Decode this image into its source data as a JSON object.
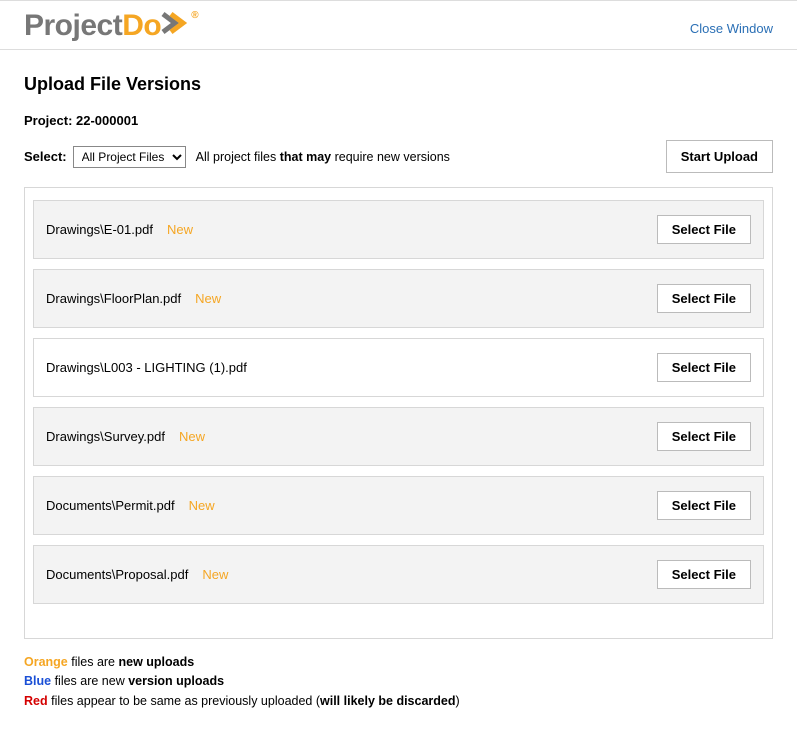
{
  "header": {
    "logo_part1": "Project",
    "logo_part2": "Do",
    "logo_reg": "®",
    "close_label": "Close Window"
  },
  "page": {
    "title": "Upload File Versions",
    "project_label": "Project: ",
    "project_value": "22-000001",
    "select_label": "Select:",
    "dropdown_value": "All Project Files",
    "hint_prefix": "All project files ",
    "hint_bold": "that may",
    "hint_suffix": " require new versions",
    "start_upload": "Start Upload",
    "select_file": "Select File",
    "new_badge": "New"
  },
  "files": [
    {
      "name": "Drawings\\E-01.pdf",
      "is_new": true
    },
    {
      "name": "Drawings\\FloorPlan.pdf",
      "is_new": true
    },
    {
      "name": "Drawings\\L003 - LIGHTING (1).pdf",
      "is_new": false
    },
    {
      "name": "Drawings\\Survey.pdf",
      "is_new": true
    },
    {
      "name": "Documents\\Permit.pdf",
      "is_new": true
    },
    {
      "name": "Documents\\Proposal.pdf",
      "is_new": true
    }
  ],
  "legend": {
    "l1_color": "Orange",
    "l1_a": " files are ",
    "l1_b": "new uploads",
    "l2_color": "Blue",
    "l2_a": " files are new ",
    "l2_b": "version uploads",
    "l3_color": "Red",
    "l3_a": " files appear to be same as previously uploaded (",
    "l3_b": "will likely be discarded",
    "l3_c": ")"
  }
}
